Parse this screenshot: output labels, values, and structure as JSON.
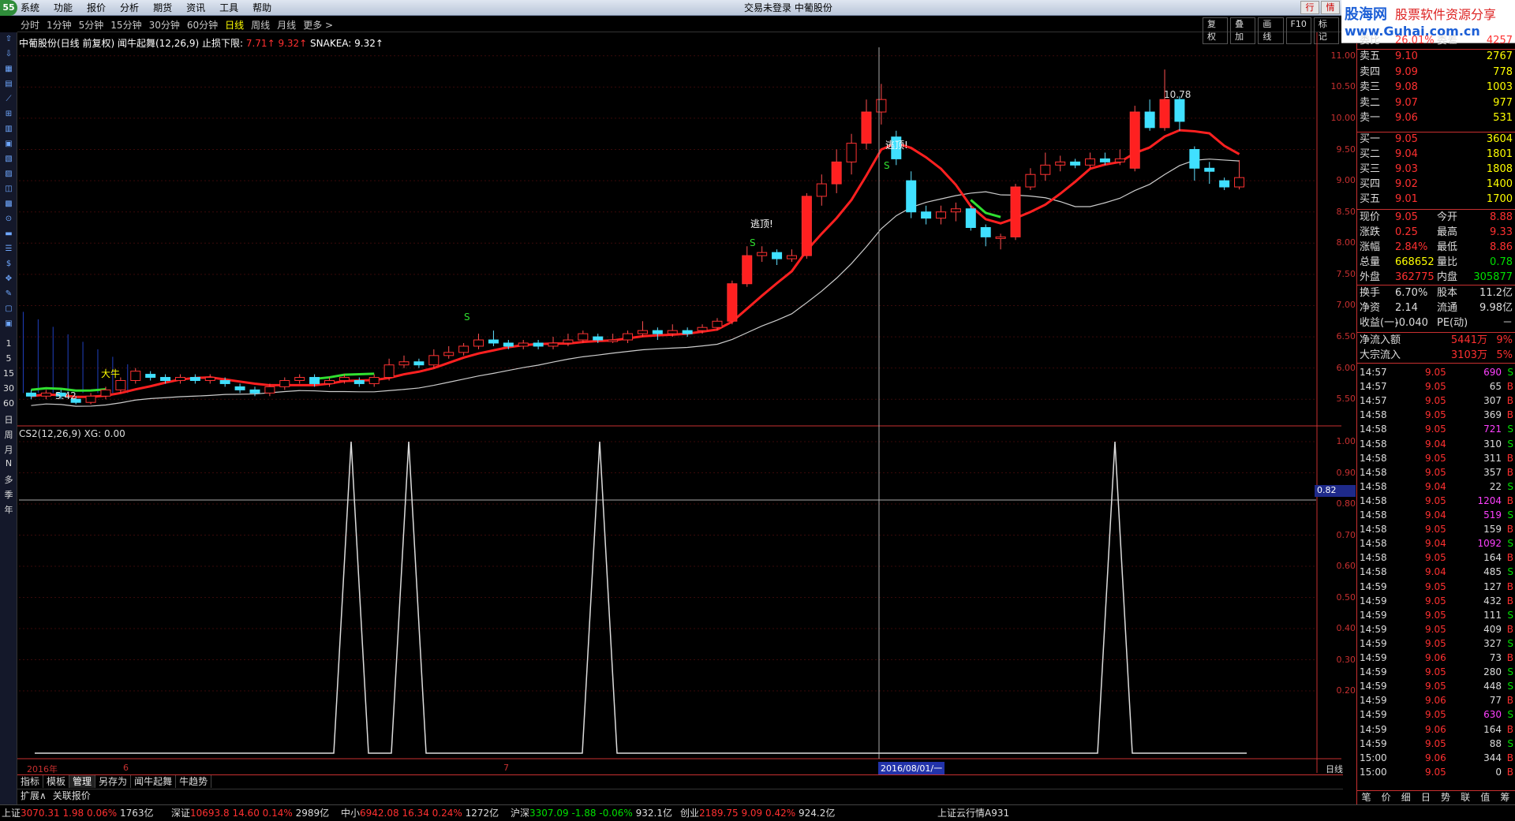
{
  "menu": {
    "logo": "55",
    "items": [
      "系统",
      "功能",
      "报价",
      "分析",
      "期货",
      "资讯",
      "工具",
      "帮助"
    ],
    "center_text": "交易未登录    中葡股份",
    "win_buttons": [
      "行",
      "情"
    ]
  },
  "brand": {
    "name": "股海网",
    "slogan": "股票软件资源分享",
    "url": "www.Guhai.com.cn"
  },
  "periods": [
    "分时",
    "1分钟",
    "5分钟",
    "15分钟",
    "30分钟",
    "60分钟",
    "日线",
    "周线",
    "月线",
    "更多 >"
  ],
  "active_period": "日线",
  "tools": [
    "复权",
    "叠加",
    "画线",
    "F10",
    "标记"
  ],
  "main_title": {
    "prefix": "中葡股份(日线 前复权) 闻牛起舞(12,26,9) 止损下限: ",
    "stop": "7.71",
    "up1": "↑",
    "sep": "  ",
    "stop2": "9.32",
    "up2": "↑",
    "snake": "  SNAKEA: 9.32↑"
  },
  "indicator_title": "CS2(12,26,9)  XG: 0.00",
  "price_axis": [
    "11.00",
    "10.50",
    "10.00",
    "9.50",
    "9.00",
    "8.50",
    "8.00",
    "7.50",
    "7.00",
    "6.50",
    "6.00",
    "5.50"
  ],
  "indicator_axis": [
    "1.00",
    "0.90",
    "0.80",
    "0.70",
    "0.60",
    "0.50",
    "0.40",
    "0.30",
    "0.20"
  ],
  "cross_value": "0.82",
  "annotations": {
    "high": "10.78",
    "low": "5.42",
    "escape": "逃顶!",
    "big": "大牛",
    "s": "S"
  },
  "x_labels": {
    "year": "2016年",
    "m6": "6",
    "m7": "7",
    "date": "2016/08/01/一",
    "daily": "日线"
  },
  "left_bar_labels": [
    "1",
    "5",
    "15",
    "30",
    "60",
    "日",
    "周",
    "月",
    "N",
    "多",
    "季",
    "年"
  ],
  "bottom_tabs": [
    "指标",
    "模板",
    "管理",
    "另存为",
    "闻牛起舞",
    "牛趋势"
  ],
  "bottom_tabs2": [
    "扩展∧",
    "关联报价"
  ],
  "quote": {
    "top_label": "委比",
    "top_value": "26.01%",
    "top_label2": "委差",
    "top_value2": "4257",
    "sell": [
      {
        "label": "卖五",
        "price": "9.10",
        "vol": "2767"
      },
      {
        "label": "卖四",
        "price": "9.09",
        "vol": "778"
      },
      {
        "label": "卖三",
        "price": "9.08",
        "vol": "1003"
      },
      {
        "label": "卖二",
        "price": "9.07",
        "vol": "977"
      },
      {
        "label": "卖一",
        "price": "9.06",
        "vol": "531"
      }
    ],
    "buy": [
      {
        "label": "买一",
        "price": "9.05",
        "vol": "3604"
      },
      {
        "label": "买二",
        "price": "9.04",
        "vol": "1801"
      },
      {
        "label": "买三",
        "price": "9.03",
        "vol": "1808"
      },
      {
        "label": "买四",
        "price": "9.02",
        "vol": "1400"
      },
      {
        "label": "买五",
        "price": "9.01",
        "vol": "1700"
      }
    ],
    "stats": [
      {
        "l1": "现价",
        "v1": "9.05",
        "c1": "red",
        "l2": "今开",
        "v2": "8.88",
        "c2": "red"
      },
      {
        "l1": "涨跌",
        "v1": "0.25",
        "c1": "red",
        "l2": "最高",
        "v2": "9.33",
        "c2": "red"
      },
      {
        "l1": "涨幅",
        "v1": "2.84%",
        "c1": "red",
        "l2": "最低",
        "v2": "8.86",
        "c2": "red"
      },
      {
        "l1": "总量",
        "v1": "668652",
        "c1": "yellow",
        "l2": "量比",
        "v2": "0.78",
        "c2": "green"
      },
      {
        "l1": "外盘",
        "v1": "362775",
        "c1": "red",
        "l2": "内盘",
        "v2": "305877",
        "c2": "green"
      }
    ],
    "stats2": [
      {
        "l1": "换手",
        "v1": "6.70%",
        "c1": "white",
        "l2": "股本",
        "v2": "11.2亿",
        "c2": "white"
      },
      {
        "l1": "净资",
        "v1": "2.14",
        "c1": "white",
        "l2": "流通",
        "v2": "9.98亿",
        "c2": "white"
      },
      {
        "l1": "收益(一)",
        "v1": "-0.040",
        "c1": "white",
        "l2": "PE(动)",
        "v2": "－",
        "c2": "white"
      }
    ],
    "flows": [
      {
        "label": "净流入额",
        "value": "5441万",
        "pct": "9%"
      },
      {
        "label": "大宗流入",
        "value": "3103万",
        "pct": "5%"
      }
    ]
  },
  "ticks": [
    {
      "t": "14:57",
      "p": "9.05",
      "v": "690",
      "bs": "S",
      "vc": "mag"
    },
    {
      "t": "14:57",
      "p": "9.05",
      "v": "65",
      "bs": "B",
      "vc": "white"
    },
    {
      "t": "14:57",
      "p": "9.05",
      "v": "307",
      "bs": "B",
      "vc": "white"
    },
    {
      "t": "14:58",
      "p": "9.05",
      "v": "369",
      "bs": "B",
      "vc": "white"
    },
    {
      "t": "14:58",
      "p": "9.05",
      "v": "721",
      "bs": "S",
      "vc": "mag"
    },
    {
      "t": "14:58",
      "p": "9.04",
      "v": "310",
      "bs": "S",
      "vc": "white"
    },
    {
      "t": "14:58",
      "p": "9.05",
      "v": "311",
      "bs": "B",
      "vc": "white"
    },
    {
      "t": "14:58",
      "p": "9.05",
      "v": "357",
      "bs": "B",
      "vc": "white"
    },
    {
      "t": "14:58",
      "p": "9.04",
      "v": "22",
      "bs": "S",
      "vc": "white"
    },
    {
      "t": "14:58",
      "p": "9.05",
      "v": "1204",
      "bs": "B",
      "vc": "mag"
    },
    {
      "t": "14:58",
      "p": "9.04",
      "v": "519",
      "bs": "S",
      "vc": "mag"
    },
    {
      "t": "14:58",
      "p": "9.05",
      "v": "159",
      "bs": "B",
      "vc": "white"
    },
    {
      "t": "14:58",
      "p": "9.04",
      "v": "1092",
      "bs": "S",
      "vc": "mag"
    },
    {
      "t": "14:58",
      "p": "9.05",
      "v": "164",
      "bs": "B",
      "vc": "white"
    },
    {
      "t": "14:58",
      "p": "9.04",
      "v": "485",
      "bs": "S",
      "vc": "white"
    },
    {
      "t": "14:59",
      "p": "9.05",
      "v": "127",
      "bs": "B",
      "vc": "white"
    },
    {
      "t": "14:59",
      "p": "9.05",
      "v": "432",
      "bs": "B",
      "vc": "white"
    },
    {
      "t": "14:59",
      "p": "9.05",
      "v": "111",
      "bs": "S",
      "vc": "white"
    },
    {
      "t": "14:59",
      "p": "9.05",
      "v": "409",
      "bs": "B",
      "vc": "white"
    },
    {
      "t": "14:59",
      "p": "9.05",
      "v": "327",
      "bs": "S",
      "vc": "white"
    },
    {
      "t": "14:59",
      "p": "9.06",
      "v": "73",
      "bs": "B",
      "vc": "white"
    },
    {
      "t": "14:59",
      "p": "9.05",
      "v": "280",
      "bs": "S",
      "vc": "white"
    },
    {
      "t": "14:59",
      "p": "9.05",
      "v": "448",
      "bs": "S",
      "vc": "white"
    },
    {
      "t": "14:59",
      "p": "9.06",
      "v": "77",
      "bs": "B",
      "vc": "white"
    },
    {
      "t": "14:59",
      "p": "9.05",
      "v": "630",
      "bs": "S",
      "vc": "mag"
    },
    {
      "t": "14:59",
      "p": "9.06",
      "v": "164",
      "bs": "B",
      "vc": "white"
    },
    {
      "t": "14:59",
      "p": "9.05",
      "v": "88",
      "bs": "S",
      "vc": "white"
    },
    {
      "t": "15:00",
      "p": "9.06",
      "v": "344",
      "bs": "B",
      "vc": "white"
    },
    {
      "t": "15:00",
      "p": "9.05",
      "v": "0",
      "bs": "B",
      "vc": "white"
    }
  ],
  "right_tabs": [
    "笔",
    "价",
    "细",
    "日",
    "势",
    "联",
    "值",
    "筹"
  ],
  "ticker": [
    {
      "name": "上证",
      "val": "3070.31",
      "chg": "1.98",
      "pct": "0.06%",
      "amt": "1763亿"
    },
    {
      "name": "深证",
      "val": "10693.8",
      "chg": "14.60",
      "pct": "0.14%",
      "amt": "2989亿"
    },
    {
      "name": "中小",
      "val": "6942.08",
      "chg": "16.34",
      "pct": "0.24%",
      "amt": "1272亿"
    },
    {
      "name": "沪深",
      "val": "3307.09",
      "chg": "-1.88",
      "pct": "-0.06%",
      "amt": "932.1亿"
    },
    {
      "name": "创业",
      "val": "2189.75",
      "chg": "9.09",
      "pct": "0.42%",
      "amt": "924.2亿"
    }
  ],
  "ticker_tail": "上证云行情A931",
  "chart_data": {
    "type": "candlestick",
    "ylim": [
      5.2,
      11.3
    ],
    "candles": [
      [
        5.6,
        5.55,
        5.65,
        5.5
      ],
      [
        5.55,
        5.6,
        5.65,
        5.5
      ],
      [
        5.6,
        5.55,
        5.65,
        5.5
      ],
      [
        5.5,
        5.45,
        5.55,
        5.42
      ],
      [
        5.45,
        5.55,
        5.6,
        5.42
      ],
      [
        5.55,
        5.65,
        5.7,
        5.5
      ],
      [
        5.65,
        5.8,
        5.85,
        5.6
      ],
      [
        5.8,
        5.95,
        6.0,
        5.75
      ],
      [
        5.9,
        5.85,
        5.95,
        5.8
      ],
      [
        5.85,
        5.8,
        5.9,
        5.75
      ],
      [
        5.8,
        5.85,
        5.9,
        5.75
      ],
      [
        5.85,
        5.8,
        5.9,
        5.75
      ],
      [
        5.8,
        5.85,
        5.9,
        5.75
      ],
      [
        5.8,
        5.75,
        5.85,
        5.7
      ],
      [
        5.7,
        5.65,
        5.75,
        5.6
      ],
      [
        5.65,
        5.6,
        5.7,
        5.55
      ],
      [
        5.6,
        5.7,
        5.75,
        5.55
      ],
      [
        5.7,
        5.8,
        5.85,
        5.65
      ],
      [
        5.8,
        5.85,
        5.9,
        5.75
      ],
      [
        5.85,
        5.75,
        5.9,
        5.7
      ],
      [
        5.75,
        5.8,
        5.85,
        5.7
      ],
      [
        5.8,
        5.85,
        5.9,
        5.75
      ],
      [
        5.8,
        5.75,
        5.85,
        5.7
      ],
      [
        5.75,
        5.85,
        5.9,
        5.7
      ],
      [
        5.85,
        6.05,
        6.15,
        5.8
      ],
      [
        6.05,
        6.1,
        6.2,
        6.0
      ],
      [
        6.1,
        6.05,
        6.15,
        6.0
      ],
      [
        6.05,
        6.2,
        6.3,
        6.0
      ],
      [
        6.2,
        6.25,
        6.35,
        6.15
      ],
      [
        6.25,
        6.35,
        6.4,
        6.2
      ],
      [
        6.35,
        6.45,
        6.55,
        6.3
      ],
      [
        6.45,
        6.4,
        6.6,
        6.35
      ],
      [
        6.4,
        6.35,
        6.45,
        6.3
      ],
      [
        6.35,
        6.4,
        6.45,
        6.3
      ],
      [
        6.4,
        6.35,
        6.45,
        6.3
      ],
      [
        6.35,
        6.4,
        6.5,
        6.3
      ],
      [
        6.4,
        6.45,
        6.55,
        6.35
      ],
      [
        6.45,
        6.55,
        6.6,
        6.4
      ],
      [
        6.5,
        6.45,
        6.55,
        6.4
      ],
      [
        6.45,
        6.45,
        6.55,
        6.4
      ],
      [
        6.45,
        6.55,
        6.6,
        6.4
      ],
      [
        6.55,
        6.6,
        6.75,
        6.5
      ],
      [
        6.6,
        6.55,
        6.65,
        6.45
      ],
      [
        6.55,
        6.6,
        6.7,
        6.5
      ],
      [
        6.6,
        6.55,
        6.65,
        6.5
      ],
      [
        6.6,
        6.65,
        6.7,
        6.55
      ],
      [
        6.65,
        6.75,
        6.8,
        6.6
      ],
      [
        6.75,
        7.35,
        7.4,
        6.7
      ],
      [
        7.35,
        7.8,
        7.95,
        7.3
      ],
      [
        7.8,
        7.85,
        7.95,
        7.7
      ],
      [
        7.85,
        7.75,
        7.9,
        7.65
      ],
      [
        7.75,
        7.8,
        7.9,
        7.7
      ],
      [
        7.8,
        8.75,
        8.8,
        7.75
      ],
      [
        8.75,
        8.95,
        9.1,
        8.6
      ],
      [
        8.95,
        9.3,
        9.5,
        8.8
      ],
      [
        9.3,
        9.6,
        9.75,
        9.1
      ],
      [
        9.6,
        10.1,
        10.3,
        9.5
      ],
      [
        10.1,
        10.3,
        10.55,
        9.9
      ],
      [
        9.7,
        9.35,
        9.8,
        9.25
      ],
      [
        9.0,
        8.5,
        9.15,
        8.4
      ],
      [
        8.5,
        8.4,
        8.6,
        8.3
      ],
      [
        8.4,
        8.5,
        8.6,
        8.3
      ],
      [
        8.5,
        8.55,
        8.65,
        8.35
      ],
      [
        8.55,
        8.25,
        8.6,
        8.2
      ],
      [
        8.25,
        8.1,
        8.3,
        7.95
      ],
      [
        8.1,
        8.1,
        8.15,
        7.9
      ],
      [
        8.1,
        8.9,
        8.95,
        8.05
      ],
      [
        8.9,
        9.1,
        9.2,
        8.85
      ],
      [
        9.1,
        9.25,
        9.45,
        9.0
      ],
      [
        9.25,
        9.3,
        9.4,
        9.15
      ],
      [
        9.3,
        9.25,
        9.35,
        9.2
      ],
      [
        9.25,
        9.35,
        9.45,
        9.2
      ],
      [
        9.35,
        9.3,
        9.45,
        9.25
      ],
      [
        9.3,
        9.35,
        9.5,
        9.25
      ],
      [
        9.2,
        10.1,
        10.2,
        9.15
      ],
      [
        10.1,
        9.85,
        10.3,
        9.8
      ],
      [
        9.85,
        10.3,
        10.78,
        9.8
      ],
      [
        10.3,
        9.95,
        10.35,
        9.8
      ],
      [
        9.5,
        9.2,
        9.55,
        9.0
      ],
      [
        9.2,
        9.15,
        9.3,
        8.95
      ],
      [
        9.0,
        8.9,
        9.05,
        8.85
      ],
      [
        8.9,
        9.05,
        9.33,
        8.86
      ]
    ]
  }
}
